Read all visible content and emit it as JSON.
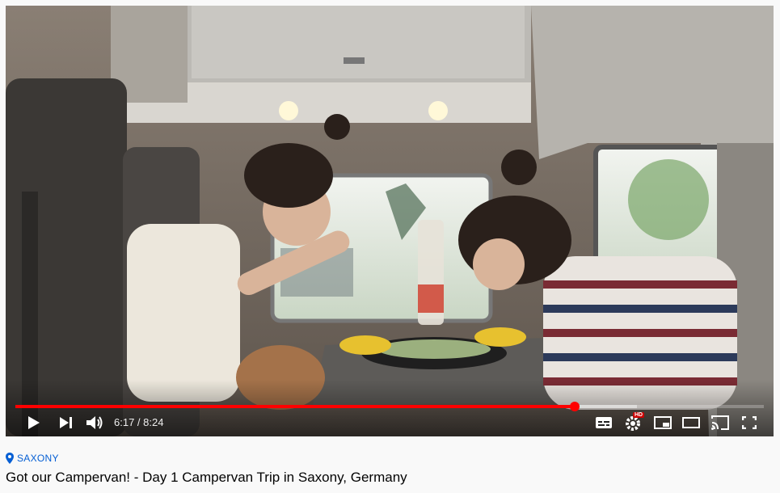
{
  "player": {
    "current_time": "6:17",
    "separator": " / ",
    "duration": "8:24",
    "progress_fraction": 0.747,
    "buffered_fraction": 0.83,
    "hd_badge": "HD"
  },
  "video": {
    "location": "SAXONY",
    "title": "Got our Campervan! - Day 1 Campervan Trip in Saxony, Germany"
  },
  "colors": {
    "progress": "#ff0000",
    "link": "#065fd4",
    "hd_badge": "#cc0000"
  },
  "icons": [
    "play-icon",
    "next-icon",
    "volume-icon",
    "subtitles-icon",
    "settings-icon",
    "miniplayer-icon",
    "theater-icon",
    "cast-icon",
    "fullscreen-icon",
    "location-pin-icon"
  ]
}
